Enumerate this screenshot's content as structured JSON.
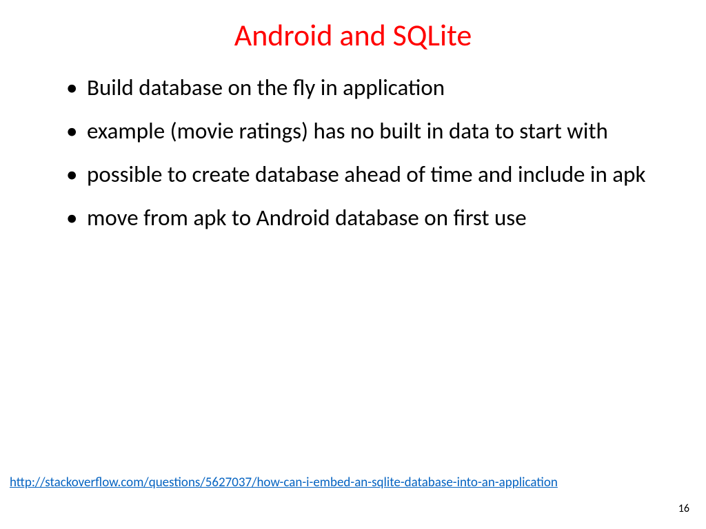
{
  "title": "Android and SQLite",
  "bullets": {
    "item0": "Build database on the fly in application",
    "item1": "example (movie ratings) has no built in data to start with",
    "item2": "possible to create database ahead of time and include in apk",
    "item3": "move from apk to Android database on first use"
  },
  "link": "http://stackoverflow.com/questions/5627037/how-can-i-embed-an-sqlite-database-into-an-application",
  "page_number": "16"
}
